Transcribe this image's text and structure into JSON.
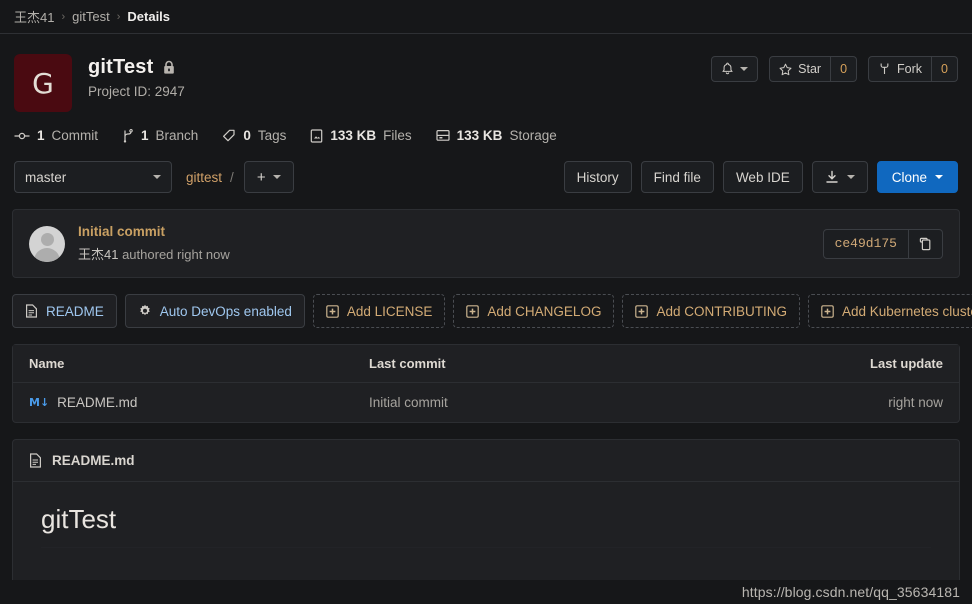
{
  "breadcrumb": {
    "owner": "王杰41",
    "project": "gitTest",
    "current": "Details",
    "separator": "›"
  },
  "project": {
    "avatar_letter": "G",
    "avatar_color": "#4a0a11",
    "title": "gitTest",
    "visibility_icon": "lock-icon",
    "id_label": "Project ID: 2947"
  },
  "header_actions": {
    "notifications": {
      "icon": "bell-icon"
    },
    "star": {
      "label": "Star",
      "icon": "star-icon",
      "count": "0"
    },
    "fork": {
      "label": "Fork",
      "icon": "fork-icon",
      "count": "0"
    }
  },
  "stats": [
    {
      "icon": "commit-icon",
      "value": "1",
      "label": "Commit"
    },
    {
      "icon": "branch-icon",
      "value": "1",
      "label": "Branch"
    },
    {
      "icon": "tag-icon",
      "value": "0",
      "label": "Tags"
    },
    {
      "icon": "file-icon",
      "value": "133 KB",
      "label": "Files"
    },
    {
      "icon": "storage-icon",
      "value": "133 KB",
      "label": "Storage"
    }
  ],
  "toolbar": {
    "branch": "master",
    "path_root": "gittest",
    "path_separator": "/",
    "add_button": "+",
    "history": "History",
    "find_file": "Find file",
    "web_ide": "Web IDE",
    "download_icon": "download-icon",
    "clone": "Clone"
  },
  "commit": {
    "title": "Initial commit",
    "author": "王杰41",
    "meta": " authored right now",
    "sha": "ce49d175",
    "copy_icon": "clipboard-icon"
  },
  "quick_actions": [
    {
      "label": "README",
      "icon": "doc-icon",
      "style": "solid"
    },
    {
      "label": "Auto DevOps enabled",
      "icon": "gear-icon",
      "style": "solid"
    },
    {
      "label": "Add LICENSE",
      "icon": "plus-square-icon",
      "style": "dashed"
    },
    {
      "label": "Add CHANGELOG",
      "icon": "plus-square-icon",
      "style": "dashed"
    },
    {
      "label": "Add CONTRIBUTING",
      "icon": "plus-square-icon",
      "style": "dashed"
    },
    {
      "label": "Add Kubernetes cluster",
      "icon": "plus-square-icon",
      "style": "dashed"
    }
  ],
  "file_table": {
    "columns": {
      "name": "Name",
      "last_commit": "Last commit",
      "last_update": "Last update"
    },
    "rows": [
      {
        "icon": "markdown-icon",
        "name": "README.md",
        "last_commit": "Initial commit",
        "last_update": "right now"
      }
    ]
  },
  "readme": {
    "filename": "README.md",
    "icon": "doc-icon",
    "heading": "gitTest"
  },
  "watermark": "https://blog.csdn.net/qq_35634181",
  "colors": {
    "page_bg": "#161719",
    "panel_bg": "#1f2023",
    "primary": "#1068bf",
    "link": "#d0a068",
    "accent_blue": "#9fc7ef"
  }
}
